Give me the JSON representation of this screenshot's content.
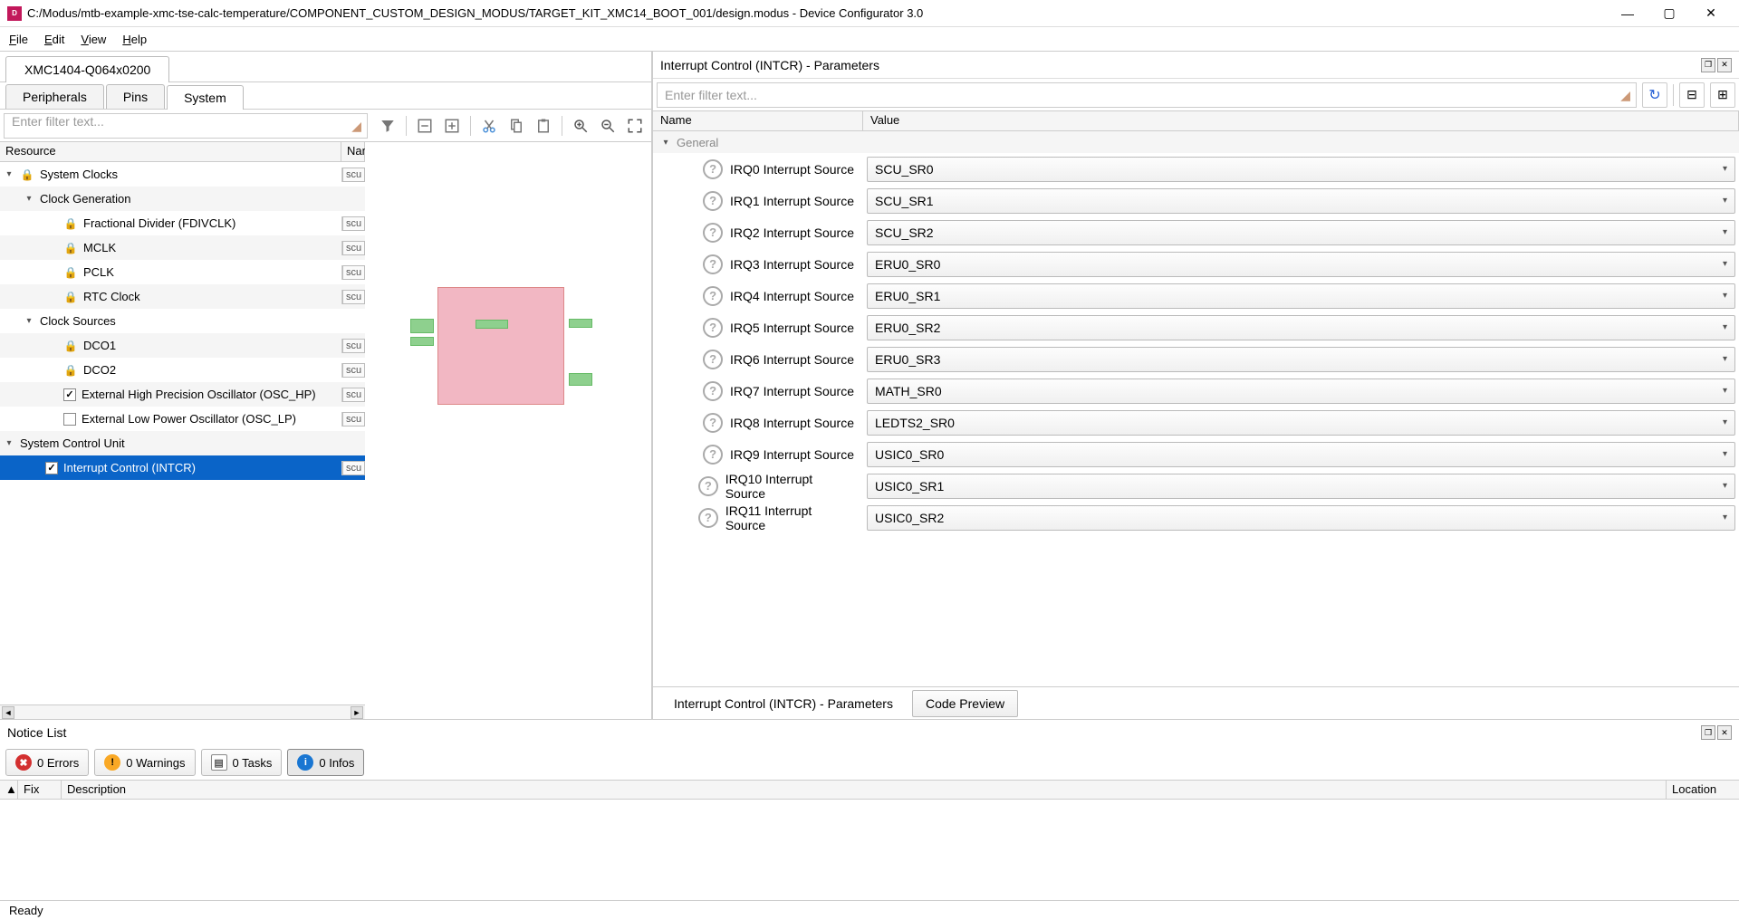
{
  "window": {
    "title": "C:/Modus/mtb-example-xmc-tse-calc-temperature/COMPONENT_CUSTOM_DESIGN_MODUS/TARGET_KIT_XMC14_BOOT_001/design.modus - Device Configurator 3.0"
  },
  "menu": {
    "file": "File",
    "edit": "Edit",
    "view": "View",
    "help": "Help"
  },
  "device_tab": "XMC1404-Q064x0200",
  "sub_tabs": {
    "peripherals": "Peripherals",
    "pins": "Pins",
    "system": "System"
  },
  "left_filter": {
    "placeholder": "Enter filter text..."
  },
  "tree_headers": {
    "resource": "Resource",
    "name": "Nam"
  },
  "tree": {
    "system_clocks": "System Clocks",
    "clock_generation": "Clock Generation",
    "fdivclk": "Fractional Divider (FDIVCLK)",
    "mclk": "MCLK",
    "pclk": "PCLK",
    "rtc": "RTC Clock",
    "clock_sources": "Clock Sources",
    "dco1": "DCO1",
    "dco2": "DCO2",
    "osc_hp": "External High Precision Oscillator (OSC_HP)",
    "osc_lp": "External Low Power Oscillator (OSC_LP)",
    "scu_unit": "System Control Unit",
    "intcr": "Interrupt Control (INTCR)",
    "scu_tag": "scu"
  },
  "params": {
    "title": "Interrupt Control (INTCR) - Parameters",
    "filter_placeholder": "Enter filter text...",
    "headers": {
      "name": "Name",
      "value": "Value"
    },
    "general": "General",
    "rows": [
      {
        "label": "IRQ0 Interrupt Source",
        "value": "SCU_SR0"
      },
      {
        "label": "IRQ1 Interrupt Source",
        "value": "SCU_SR1"
      },
      {
        "label": "IRQ2 Interrupt Source",
        "value": "SCU_SR2"
      },
      {
        "label": "IRQ3 Interrupt Source",
        "value": "ERU0_SR0"
      },
      {
        "label": "IRQ4 Interrupt Source",
        "value": "ERU0_SR1"
      },
      {
        "label": "IRQ5 Interrupt Source",
        "value": "ERU0_SR2"
      },
      {
        "label": "IRQ6 Interrupt Source",
        "value": "ERU0_SR3"
      },
      {
        "label": "IRQ7 Interrupt Source",
        "value": "MATH_SR0"
      },
      {
        "label": "IRQ8 Interrupt Source",
        "value": "LEDTS2_SR0"
      },
      {
        "label": "IRQ9 Interrupt Source",
        "value": "USIC0_SR0"
      },
      {
        "label": "IRQ10 Interrupt Source",
        "value": "USIC0_SR1"
      },
      {
        "label": "IRQ11 Interrupt Source",
        "value": "USIC0_SR2"
      }
    ],
    "bottom_tabs": {
      "params": "Interrupt Control (INTCR) - Parameters",
      "preview": "Code Preview"
    }
  },
  "notice": {
    "title": "Notice List",
    "errors": "0 Errors",
    "warnings": "0 Warnings",
    "tasks": "0 Tasks",
    "infos": "0 Infos",
    "headers": {
      "fix": "Fix",
      "desc": "Description",
      "loc": "Location"
    }
  },
  "status": "Ready"
}
